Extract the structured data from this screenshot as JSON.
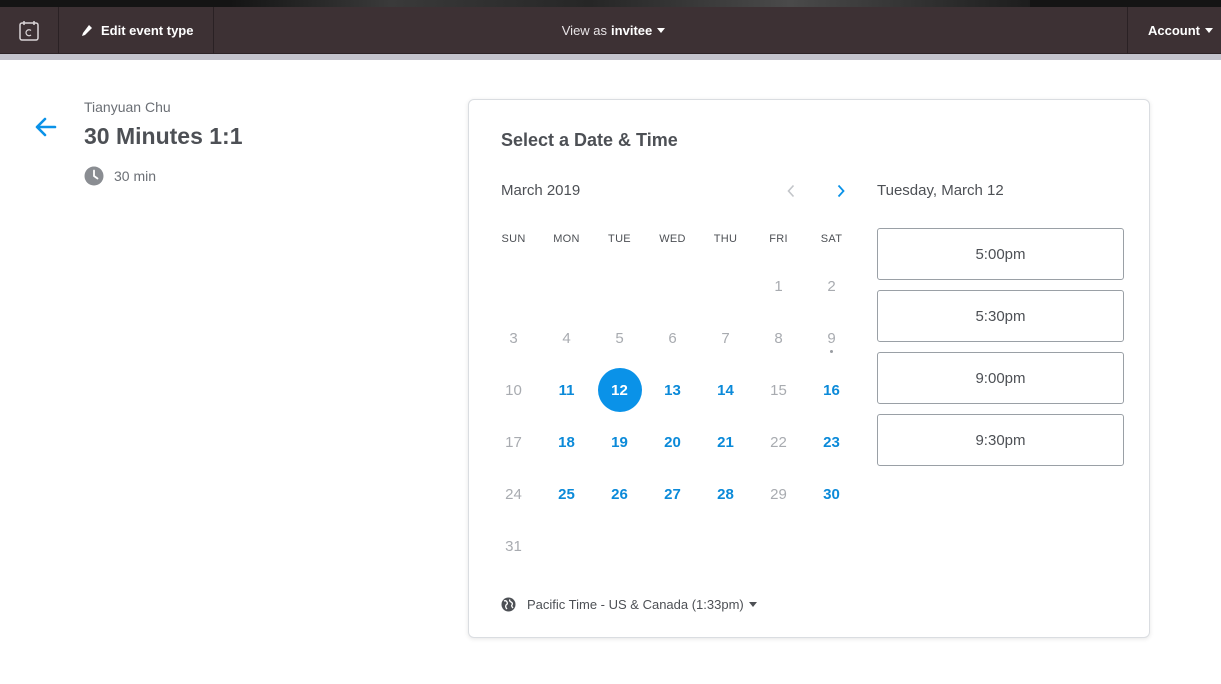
{
  "nav": {
    "edit_label": "Edit event type",
    "view_prefix": "View as",
    "view_value": "invitee",
    "account_label": "Account"
  },
  "event": {
    "organizer": "Tianyuan Chu",
    "title": "30 Minutes 1:1",
    "duration": "30 min"
  },
  "calendar": {
    "heading": "Select a Date & Time",
    "month": "March 2019",
    "weekdays": [
      "SUN",
      "MON",
      "TUE",
      "WED",
      "THU",
      "FRI",
      "SAT"
    ],
    "days": [
      {
        "label": "",
        "state": "empty"
      },
      {
        "label": "",
        "state": "empty"
      },
      {
        "label": "",
        "state": "empty"
      },
      {
        "label": "",
        "state": "empty"
      },
      {
        "label": "",
        "state": "empty"
      },
      {
        "label": "1",
        "state": "disabled"
      },
      {
        "label": "2",
        "state": "disabled"
      },
      {
        "label": "3",
        "state": "disabled"
      },
      {
        "label": "4",
        "state": "disabled"
      },
      {
        "label": "5",
        "state": "disabled"
      },
      {
        "label": "6",
        "state": "disabled"
      },
      {
        "label": "7",
        "state": "disabled"
      },
      {
        "label": "8",
        "state": "disabled"
      },
      {
        "label": "9",
        "state": "disabled",
        "today": true
      },
      {
        "label": "10",
        "state": "disabled"
      },
      {
        "label": "11",
        "state": "available"
      },
      {
        "label": "12",
        "state": "selected"
      },
      {
        "label": "13",
        "state": "available"
      },
      {
        "label": "14",
        "state": "available"
      },
      {
        "label": "15",
        "state": "disabled"
      },
      {
        "label": "16",
        "state": "available"
      },
      {
        "label": "17",
        "state": "disabled"
      },
      {
        "label": "18",
        "state": "available"
      },
      {
        "label": "19",
        "state": "available"
      },
      {
        "label": "20",
        "state": "available"
      },
      {
        "label": "21",
        "state": "available"
      },
      {
        "label": "22",
        "state": "disabled"
      },
      {
        "label": "23",
        "state": "available"
      },
      {
        "label": "24",
        "state": "disabled"
      },
      {
        "label": "25",
        "state": "available"
      },
      {
        "label": "26",
        "state": "available"
      },
      {
        "label": "27",
        "state": "available"
      },
      {
        "label": "28",
        "state": "available"
      },
      {
        "label": "29",
        "state": "disabled"
      },
      {
        "label": "30",
        "state": "available"
      },
      {
        "label": "31",
        "state": "disabled"
      }
    ],
    "timezone": "Pacific Time - US & Canada (1:33pm)"
  },
  "times": {
    "date_heading": "Tuesday, March 12",
    "slots": [
      "5:00pm",
      "5:30pm",
      "9:00pm",
      "9:30pm"
    ]
  },
  "colors": {
    "accent": "#0a92e8",
    "navbar": "#3d3134"
  }
}
